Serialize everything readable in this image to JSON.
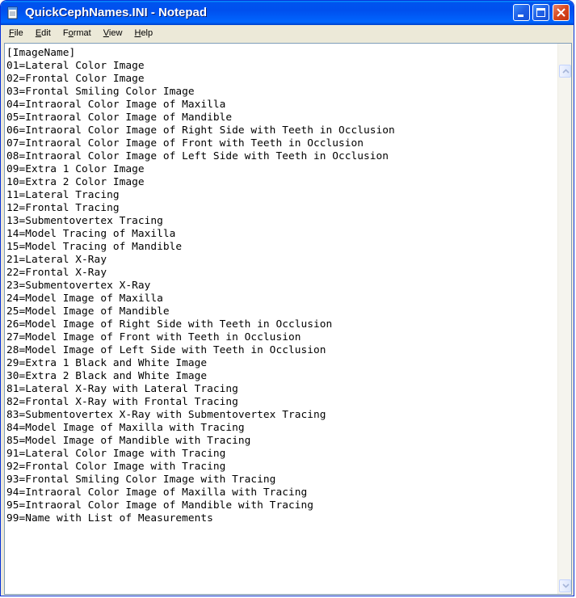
{
  "window": {
    "title": "QuickCephNames.INI - Notepad"
  },
  "menu": [
    {
      "label": "File",
      "mnemonic": "F",
      "rest": "ile"
    },
    {
      "label": "Edit",
      "mnemonic": "E",
      "rest": "dit"
    },
    {
      "label": "Format",
      "mnemonic": "o",
      "pre": "F",
      "rest": "rmat"
    },
    {
      "label": "View",
      "mnemonic": "V",
      "rest": "iew"
    },
    {
      "label": "Help",
      "mnemonic": "H",
      "rest": "elp"
    }
  ],
  "document": {
    "lines": [
      "[ImageName]",
      "01=Lateral Color Image",
      "02=Frontal Color Image",
      "03=Frontal Smiling Color Image",
      "04=Intraoral Color Image of Maxilla",
      "05=Intraoral Color Image of Mandible",
      "06=Intraoral Color Image of Right Side with Teeth in Occlusion",
      "07=Intraoral Color Image of Front with Teeth in Occlusion",
      "08=Intraoral Color Image of Left Side with Teeth in Occlusion",
      "09=Extra 1 Color Image",
      "10=Extra 2 Color Image",
      "11=Lateral Tracing",
      "12=Frontal Tracing",
      "13=Submentovertex Tracing",
      "14=Model Tracing of Maxilla",
      "15=Model Tracing of Mandible",
      "21=Lateral X-Ray",
      "22=Frontal X-Ray",
      "23=Submentovertex X-Ray",
      "24=Model Image of Maxilla",
      "25=Model Image of Mandible",
      "26=Model Image of Right Side with Teeth in Occlusion",
      "27=Model Image of Front with Teeth in Occlusion",
      "28=Model Image of Left Side with Teeth in Occlusion",
      "29=Extra 1 Black and White Image",
      "30=Extra 2 Black and White Image",
      "81=Lateral X-Ray with Lateral Tracing",
      "82=Frontal X-Ray with Frontal Tracing",
      "83=Submentovertex X-Ray with Submentovertex Tracing",
      "84=Model Image of Maxilla with Tracing",
      "85=Model Image of Mandible with Tracing",
      "91=Lateral Color Image with Tracing",
      "92=Frontal Color Image with Tracing",
      "93=Frontal Smiling Color Image with Tracing",
      "94=Intraoral Color Image of Maxilla with Tracing",
      "95=Intraoral Color Image of Mandible with Tracing",
      "99=Name with List of Measurements"
    ]
  },
  "icons": {
    "app": "notepad-icon",
    "minimize": "minimize-icon",
    "maximize": "maximize-icon",
    "close": "close-icon",
    "scroll_up": "arrow-up-icon",
    "scroll_down": "arrow-down-icon"
  },
  "colors": {
    "titlebar": "#0053ee",
    "close_button": "#d8471d",
    "window_bg": "#ece9d8"
  }
}
